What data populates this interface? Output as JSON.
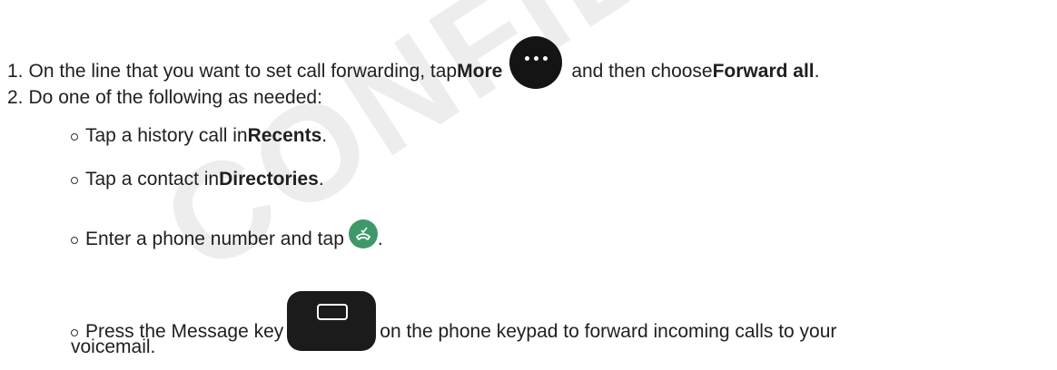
{
  "watermark": "CONFIDENTIAL",
  "steps": [
    {
      "number": "1.",
      "pre": "On the line that you want to set call forwarding, tap ",
      "bold1": "More",
      "mid": "and then choose ",
      "bold2": "Forward all",
      "post": "."
    },
    {
      "number": "2.",
      "text": "Do one of the following as needed:"
    }
  ],
  "subitems": [
    {
      "pre": "Tap a history call in ",
      "bold": "Recents",
      "post": "."
    },
    {
      "pre": "Tap a contact in ",
      "bold": "Directories",
      "post": "."
    },
    {
      "pre": "Enter a phone number and tap ",
      "post": "."
    },
    {
      "pre": "Press the Message key ",
      "post": "on the phone keypad to forward incoming calls to your",
      "cont": "voicemail."
    }
  ],
  "icons": {
    "more": "more-icon",
    "call": "call-icon",
    "message_key": "voicemail-key-icon"
  },
  "colors": {
    "call_icon": "#3f9868",
    "dark_button": "#141414"
  }
}
